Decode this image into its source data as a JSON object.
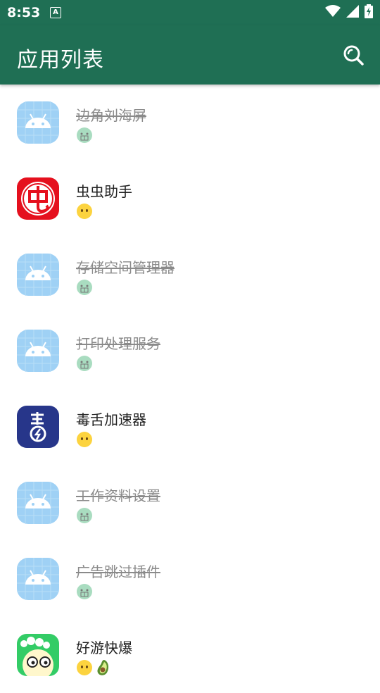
{
  "status_bar": {
    "time": "8:53",
    "notification_letter": "A"
  },
  "app_bar": {
    "title": "应用列表",
    "search_icon": "search-icon"
  },
  "colors": {
    "primary": "#1f6f54",
    "disabled_text": "#8a8a8a"
  },
  "apps": [
    {
      "name": "边角刘海屏",
      "icon": "android-default",
      "disabled": true,
      "tags": [
        "disabled-face"
      ]
    },
    {
      "name": "虫虫助手",
      "icon": "chongchong",
      "disabled": false,
      "tags": [
        "neutral-face"
      ]
    },
    {
      "name": "存储空间管理器",
      "icon": "android-default",
      "disabled": true,
      "tags": [
        "disabled-face"
      ]
    },
    {
      "name": "打印处理服务",
      "icon": "android-default",
      "disabled": true,
      "tags": [
        "disabled-face"
      ]
    },
    {
      "name": "毒舌加速器",
      "icon": "dushe",
      "disabled": false,
      "tags": [
        "neutral-face"
      ]
    },
    {
      "name": "工作资料设置",
      "icon": "android-default",
      "disabled": true,
      "tags": [
        "disabled-face"
      ]
    },
    {
      "name": "广告跳过插件",
      "icon": "android-default",
      "disabled": true,
      "tags": [
        "disabled-face"
      ]
    },
    {
      "name": "好游快爆",
      "icon": "haoyou",
      "disabled": false,
      "tags": [
        "neutral-face",
        "avocado"
      ]
    }
  ]
}
